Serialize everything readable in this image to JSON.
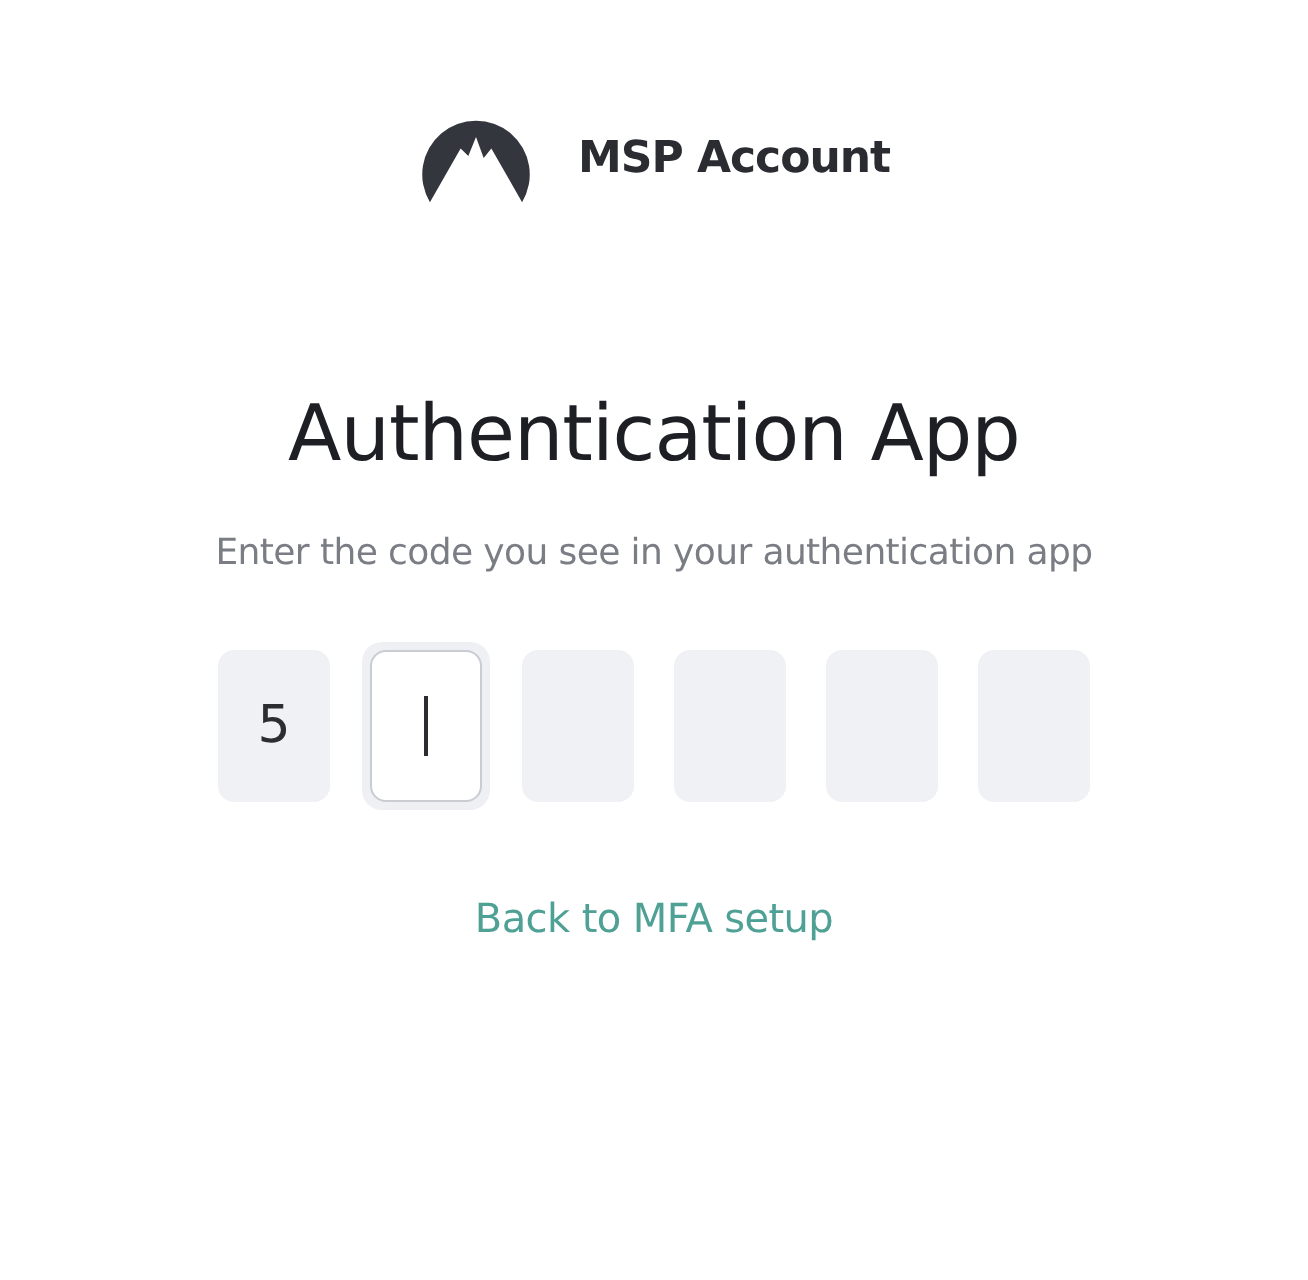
{
  "brand": {
    "name": "MSP Account"
  },
  "title": "Authentication App",
  "subtitle": "Enter the code you see in your authentication app",
  "code_digits": [
    {
      "value": "5",
      "focused": false
    },
    {
      "focused": true
    },
    {
      "focused": false
    },
    {
      "focused": false
    },
    {
      "focused": false
    },
    {
      "focused": false
    }
  ],
  "link": "Back to MFA setup"
}
